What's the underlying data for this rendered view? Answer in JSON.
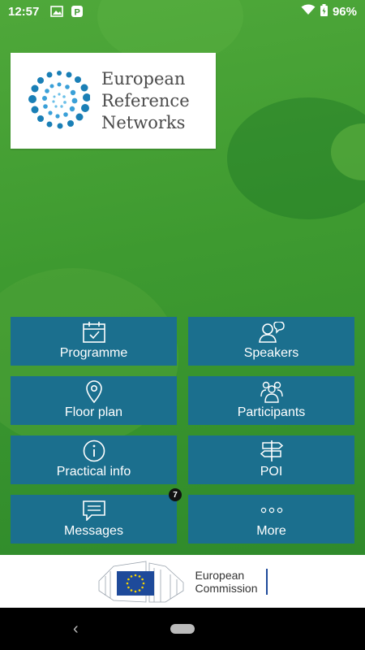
{
  "status_bar": {
    "time": "12:57",
    "battery": "96%"
  },
  "app": {
    "logo_lines": [
      "European",
      "Reference",
      "Networks"
    ]
  },
  "menu": [
    {
      "label": "Programme",
      "icon": "calendar-icon"
    },
    {
      "label": "Speakers",
      "icon": "speakers-icon"
    },
    {
      "label": "Floor plan",
      "icon": "location-pin-icon"
    },
    {
      "label": "Participants",
      "icon": "participants-icon"
    },
    {
      "label": "Practical info",
      "icon": "info-icon"
    },
    {
      "label": "POI",
      "icon": "signpost-icon"
    },
    {
      "label": "Messages",
      "icon": "message-icon",
      "badge": "7"
    },
    {
      "label": "More",
      "icon": "more-dots-icon"
    }
  ],
  "footer": {
    "org_line1": "European",
    "org_line2": "Commission"
  },
  "colors": {
    "tile": "#1b6f8e",
    "background": "#3f9a32",
    "logo_blue": "#1a7fb6"
  }
}
